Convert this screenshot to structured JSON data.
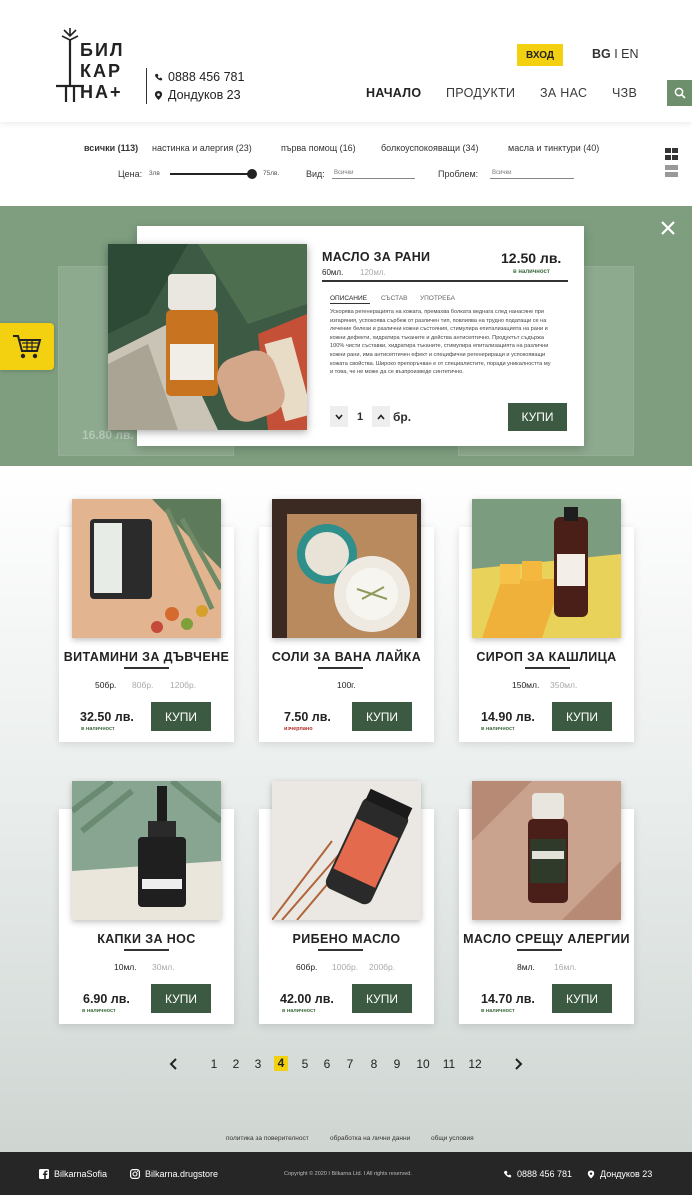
{
  "header": {
    "logo_text": [
      "БИЛ",
      "КАР",
      "НА+"
    ],
    "phone": "0888 456 781",
    "address": "Дондуков 23",
    "login_label": "ВХОД",
    "lang_bg": "BG",
    "lang_sep": " I ",
    "lang_en": "EN",
    "nav": [
      "НАЧАЛО",
      "ПРОДУКТИ",
      "ЗА НАС",
      "ЧЗВ"
    ]
  },
  "filters": {
    "categories": [
      "всички (113)",
      "настинка и алергия (23)",
      "първа помощ (16)",
      "болкоуспокояващи (34)",
      "масла и тинктури (40)"
    ],
    "price_label": "Цена:",
    "price_min": "3лв",
    "price_max": "75лв.",
    "type_label": "Вид:",
    "type_value": "Всички",
    "problem_label": "Проблем:",
    "problem_value": "Всички"
  },
  "modal": {
    "title": "МАСЛО ЗА РАНИ",
    "price": "12.50 лв.",
    "stock": "в наличност",
    "sizes": [
      "60мл.",
      "120мл."
    ],
    "tabs": [
      "ОПИСАНИЕ",
      "СЪСТАВ",
      "УПОТРЕБА"
    ],
    "description": "Ускорява регенерацията на кожата, премахва болката веднага след нанасяне при изгаряния, успокоява сърбеж от различен тип, повлиява на трудно податащи се на лечение белези и различни кожни състояния, стимулира епитализацията на рани и кожни дефекти, хидратира тъканите и действа антисептично. Продуктът съдържа 100% чисти съставки, хидратира тъканите, стимулира епитализацията на различни кожни рани, има антисептичен ефект и специфични регенериращи и успокояващи кожата свойства. Широко препоръчван е от специалистите, поради уникалността му и това, че не може да се възпроизведе синтетично.",
    "qty": "1",
    "unit": "бр.",
    "buy_label": "КУПИ",
    "ghost_price": "16.80 лв."
  },
  "products": [
    {
      "name": "ВИТАМИНИ ЗА ДЪВЧЕНЕ",
      "sizes": [
        "50бр.",
        "80бр.",
        "120бр."
      ],
      "price": "32.50 лв.",
      "stock": "в наличност",
      "in_stock": true,
      "buy": "КУПИ"
    },
    {
      "name": "СОЛИ ЗА ВАНА ЛАЙКА",
      "sizes": [
        "100г."
      ],
      "price": "7.50 лв.",
      "stock": "изчерпано",
      "in_stock": false,
      "buy": "КУПИ"
    },
    {
      "name": "СИРОП ЗА КАШЛИЦА",
      "sizes": [
        "150мл.",
        "350мл."
      ],
      "price": "14.90 лв.",
      "stock": "в наличност",
      "in_stock": true,
      "buy": "КУПИ"
    },
    {
      "name": "КАПКИ ЗА НОС",
      "sizes": [
        "10мл.",
        "30мл."
      ],
      "price": "6.90 лв.",
      "stock": "в наличност",
      "in_stock": true,
      "buy": "КУПИ"
    },
    {
      "name": "РИБЕНО МАСЛО",
      "sizes": [
        "60бр.",
        "100бр.",
        "200бр."
      ],
      "price": "42.00 лв.",
      "stock": "в наличност",
      "in_stock": true,
      "buy": "КУПИ"
    },
    {
      "name": "МАСЛО СРЕЩУ АЛЕРГИИ",
      "sizes": [
        "8мл.",
        "16мл."
      ],
      "price": "14.70 лв.",
      "stock": "в наличност",
      "in_stock": true,
      "buy": "КУПИ"
    }
  ],
  "pagination": {
    "pages": [
      "1",
      "2",
      "3",
      "4",
      "5",
      "6",
      "7",
      "8",
      "9",
      "10",
      "11",
      "12"
    ],
    "current": "4"
  },
  "legal": [
    "политика за поверителност",
    "обработка на лични данни",
    "общи условия"
  ],
  "footer": {
    "facebook": "BilkarnaSofia",
    "instagram": "Bilkarna.drugstore",
    "copyright": "Copyright © 2020  I  Bilkarna Ltd.  I  All rights reserved.",
    "phone": "0888 456 781",
    "address": "Дондуков 23"
  },
  "colors": {
    "accent": "#f3d111",
    "brand_green": "#3c5a41",
    "band_green": "#7e9e7f",
    "in_stock": "#3e6b3f",
    "out_of_stock": "#b2302b"
  }
}
